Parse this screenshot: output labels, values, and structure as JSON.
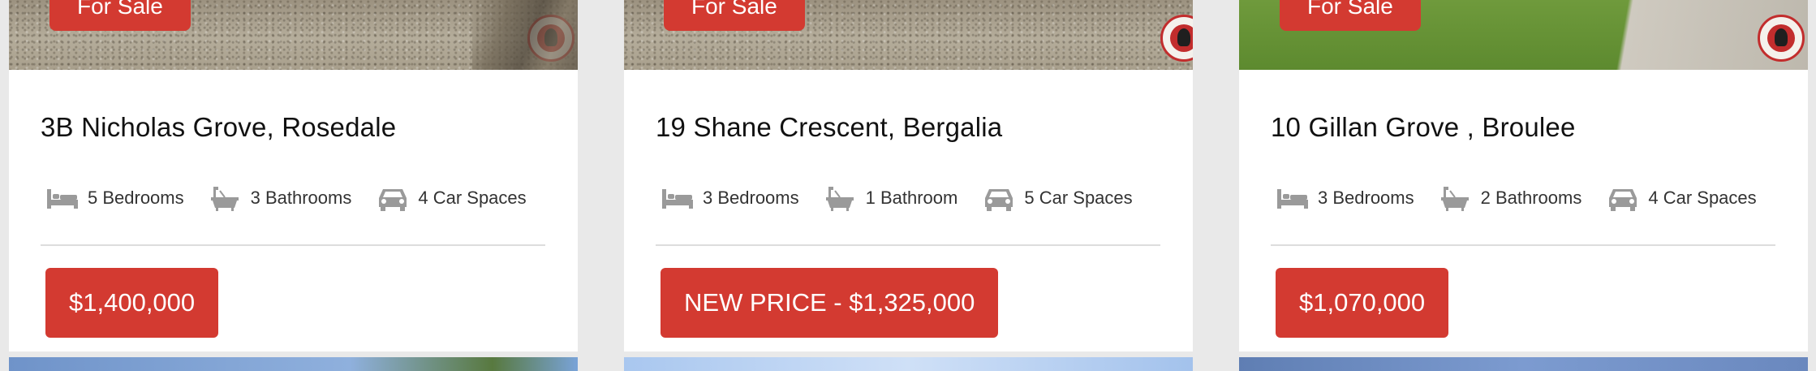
{
  "colors": {
    "accent": "#d33a31",
    "background": "#e9e9e9",
    "card": "#ffffff"
  },
  "listings": [
    {
      "tag": "For Sale",
      "address": "3B Nicholas Grove, Rosedale",
      "bedrooms": "5 Bedrooms",
      "bathrooms": "3 Bathrooms",
      "car_spaces": "4 Car Spaces",
      "price": "$1,400,000"
    },
    {
      "tag": "For Sale",
      "address": "19 Shane Crescent, Bergalia",
      "bedrooms": "3 Bedrooms",
      "bathrooms": "1 Bathroom",
      "car_spaces": "5 Car Spaces",
      "price": "NEW PRICE - $1,325,000"
    },
    {
      "tag": "For Sale",
      "address": "10 Gillan Grove , Broulee",
      "bedrooms": "3 Bedrooms",
      "bathrooms": "2 Bathrooms",
      "car_spaces": "4 Car Spaces",
      "price": "$1,070,000"
    }
  ],
  "icons": {
    "bed": "bed-icon",
    "bath": "bath-icon",
    "car": "car-icon",
    "logo": "agency-logo"
  }
}
